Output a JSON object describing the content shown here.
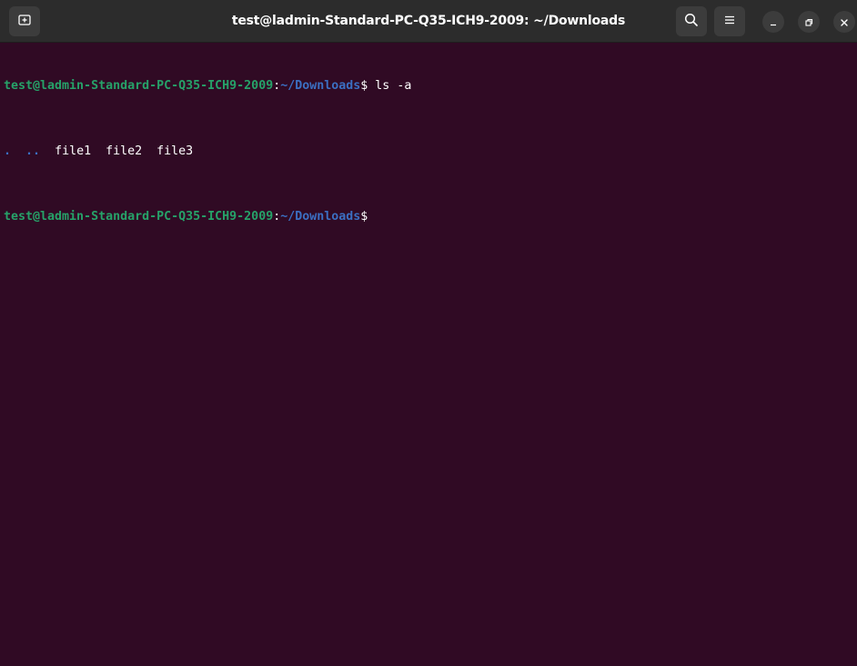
{
  "window": {
    "title": "test@ladmin-Standard-PC-Q35-ICH9-2009: ~/Downloads"
  },
  "toolbar": {
    "new_tab_icon": "new-tab-icon",
    "search_icon": "search-icon",
    "menu_icon": "hamburger-menu-icon",
    "minimize_icon": "minimize-icon",
    "maximize_icon": "restore-icon",
    "close_icon": "close-icon"
  },
  "terminal": {
    "lines": [
      {
        "user_host": "test@ladmin-Standard-PC-Q35-ICH9-2009",
        "separator": ":",
        "path": "~/Downloads",
        "prompt_symbol": "$",
        "command": " ls -a"
      },
      {
        "entries": [
          {
            "name": ".",
            "type": "dir"
          },
          {
            "name": "..",
            "type": "dir"
          },
          {
            "name": "file1",
            "type": "file"
          },
          {
            "name": "file2",
            "type": "file"
          },
          {
            "name": "file3",
            "type": "file"
          }
        ]
      },
      {
        "user_host": "test@ladmin-Standard-PC-Q35-ICH9-2009",
        "separator": ":",
        "path": "~/Downloads",
        "prompt_symbol": "$",
        "command": ""
      }
    ]
  },
  "colors": {
    "background": "#300a24",
    "titlebar": "#2c2c2c",
    "user_host": "#26a269",
    "path": "#3b6fc2",
    "text": "#ffffff"
  }
}
